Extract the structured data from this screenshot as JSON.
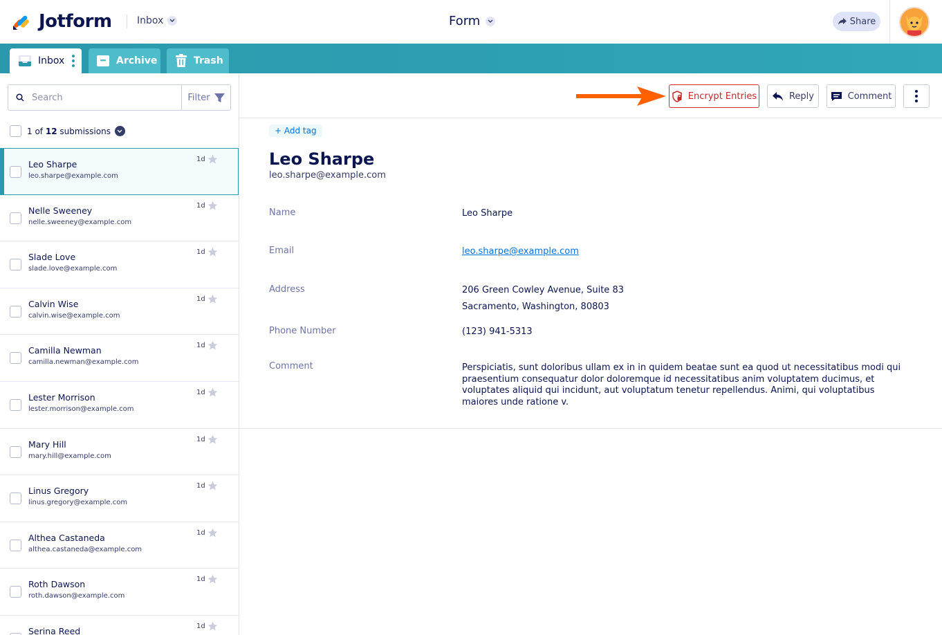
{
  "app": {
    "name": "Jotform"
  },
  "header": {
    "folder_select": "Inbox",
    "form_select": "Form",
    "share_label": "Share"
  },
  "tabs": [
    {
      "label": "Inbox"
    },
    {
      "label": "Archive"
    },
    {
      "label": "Trash"
    }
  ],
  "search": {
    "placeholder": "Search",
    "filter_label": "Filter"
  },
  "count": {
    "current": "1",
    "of_text": "of",
    "total": "12",
    "suffix": "submissions"
  },
  "submissions": [
    {
      "name": "Leo Sharpe",
      "email": "leo.sharpe@example.com",
      "time": "1d",
      "active": true
    },
    {
      "name": "Nelle Sweeney",
      "email": "nelle.sweeney@example.com",
      "time": "1d"
    },
    {
      "name": "Slade Love",
      "email": "slade.love@example.com",
      "time": "1d"
    },
    {
      "name": "Calvin Wise",
      "email": "calvin.wise@example.com",
      "time": "1d"
    },
    {
      "name": "Camilla Newman",
      "email": "camilla.newman@example.com",
      "time": "1d"
    },
    {
      "name": "Lester Morrison",
      "email": "lester.morrison@example.com",
      "time": "1d"
    },
    {
      "name": "Mary Hill",
      "email": "mary.hill@example.com",
      "time": "1d"
    },
    {
      "name": "Linus Gregory",
      "email": "linus.gregory@example.com",
      "time": "1d"
    },
    {
      "name": "Althea Castaneda",
      "email": "althea.castaneda@example.com",
      "time": "1d"
    },
    {
      "name": "Roth Dawson",
      "email": "roth.dawson@example.com",
      "time": "1d"
    },
    {
      "name": "Serina Reed",
      "email": "",
      "time": "1d"
    }
  ],
  "toolbar": {
    "encrypt_label": "Encrypt Entries",
    "reply_label": "Reply",
    "comment_label": "Comment"
  },
  "detail": {
    "add_tag": "+ Add tag",
    "name": "Leo Sharpe",
    "email": "leo.sharpe@example.com",
    "fields": {
      "name": {
        "label": "Name",
        "value": "Leo Sharpe"
      },
      "email": {
        "label": "Email",
        "value": "leo.sharpe@example.com"
      },
      "address": {
        "label": "Address",
        "line1": "206 Green Cowley Avenue, Suite 83",
        "line2": "Sacramento, Washington, 80803"
      },
      "phone": {
        "label": "Phone Number",
        "value": "(123) 941-5313"
      },
      "comment": {
        "label": "Comment",
        "value": "Perspiciatis, sunt doloribus ullam ex in in quidem beatae sunt ea quod ut necessitatibus modi qui praesentium consequatur dolor doloremque id necessitatibus anim voluptatem ducimus, et voluptates aliquid qui incidunt, aut voluptatum tenetur repellendus. Animi, qui voluptatibus maiores unde ratione v."
      }
    }
  },
  "colors": {
    "brand_teal": "#2a99ab",
    "navy": "#0a1551",
    "encrypt_red": "#c62828",
    "arrow_orange": "#ff6100",
    "link_blue": "#0075e3"
  },
  "icons": [
    "jotform-logo-icon",
    "chevron-down-icon",
    "share-arrow-icon",
    "avatar-icon",
    "inbox-tray-icon",
    "archive-box-icon",
    "trash-can-icon",
    "search-icon",
    "filter-funnel-icon",
    "star-icon",
    "shield-lock-icon",
    "reply-arrow-icon",
    "comment-bubble-icon",
    "more-vertical-icon",
    "orange-arrow-icon"
  ]
}
